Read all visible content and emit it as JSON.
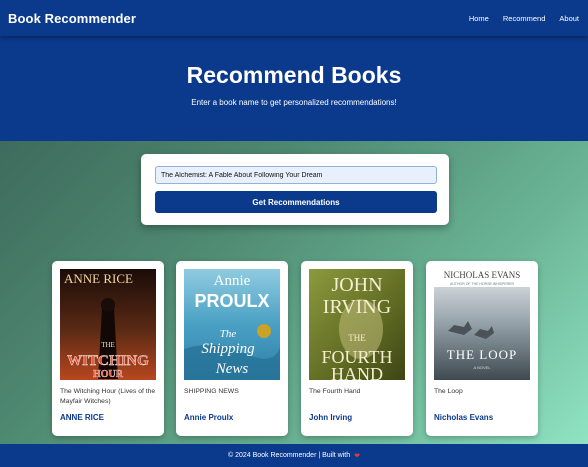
{
  "navbar": {
    "brand": "Book Recommender",
    "links": [
      "Home",
      "Recommend",
      "About"
    ]
  },
  "hero": {
    "title": "Recommend Books",
    "subtitle": "Enter a book name to get personalized recommendations!"
  },
  "search": {
    "value": "The Alchemist: A Fable About Following Your Dream",
    "button_label": "Get Recommendations"
  },
  "books": [
    {
      "title": "The Witching Hour (Lives of the Mayfair Witches)",
      "author": "ANNE RICE",
      "cover": {
        "top_text": "ANNE RICE",
        "bottom_text": "The Witching Hour",
        "bg": "#3a1a10",
        "accent": "#c0392b"
      }
    },
    {
      "title": "SHIPPING NEWS",
      "author": "Annie Proulx",
      "cover": {
        "top_text": "Annie PROULX",
        "bottom_text": "The Shipping News",
        "bg": "#4fa6c8",
        "accent": "#ffffff"
      }
    },
    {
      "title": "The Fourth Hand",
      "author": "John Irving",
      "cover": {
        "top_text": "JOHN IRVING",
        "bottom_text": "The Fourth Hand",
        "bg": "#6f7a2e",
        "accent": "#f0e4b0"
      }
    },
    {
      "title": "The Loop",
      "author": "Nicholas Evans",
      "cover": {
        "top_text": "NICHOLAS EVANS",
        "bottom_text": "THE LOOP",
        "bg": "#8a9aa6",
        "accent": "#ffffff"
      }
    }
  ],
  "footer": {
    "text": "© 2024 Book Recommender | Built with",
    "icon": "heart-icon"
  }
}
